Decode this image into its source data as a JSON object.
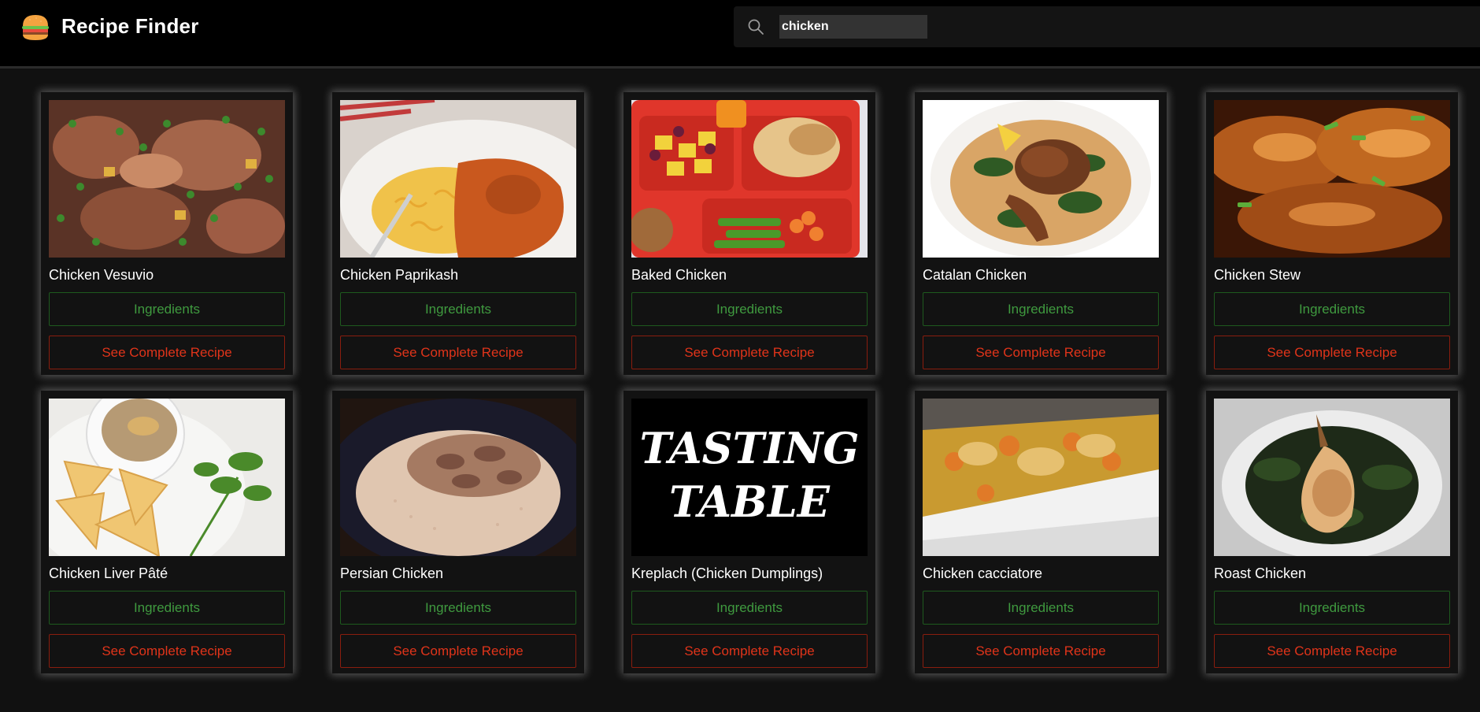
{
  "app": {
    "title": "Recipe Finder",
    "logo_icon": "burger-icon"
  },
  "search": {
    "value": "chicken",
    "icon": "search-icon"
  },
  "colors": {
    "background": "#111111",
    "header": "#000000",
    "ingredients_text": "#3f9a3f",
    "recipe_text": "#e0341a"
  },
  "recipes": [
    {
      "title": "Chicken Vesuvio",
      "ingredients_label": "Ingredients",
      "recipe_label": "See Complete Recipe"
    },
    {
      "title": "Chicken Paprikash",
      "ingredients_label": "Ingredients",
      "recipe_label": "See Complete Recipe"
    },
    {
      "title": "Baked Chicken",
      "ingredients_label": "Ingredients",
      "recipe_label": "See Complete Recipe"
    },
    {
      "title": "Catalan Chicken",
      "ingredients_label": "Ingredients",
      "recipe_label": "See Complete Recipe"
    },
    {
      "title": "Chicken Stew",
      "ingredients_label": "Ingredients",
      "recipe_label": "See Complete Recipe"
    },
    {
      "title": "Chicken Liver Pâté",
      "ingredients_label": "Ingredients",
      "recipe_label": "See Complete Recipe"
    },
    {
      "title": "Persian Chicken",
      "ingredients_label": "Ingredients",
      "recipe_label": "See Complete Recipe"
    },
    {
      "title": "Kreplach (Chicken Dumplings)",
      "ingredients_label": "Ingredients",
      "recipe_label": "See Complete Recipe",
      "image_logo_text": [
        "TASTING",
        "TABLE"
      ]
    },
    {
      "title": "Chicken cacciatore",
      "ingredients_label": "Ingredients",
      "recipe_label": "See Complete Recipe"
    },
    {
      "title": "Roast Chicken",
      "ingredients_label": "Ingredients",
      "recipe_label": "See Complete Recipe"
    }
  ]
}
